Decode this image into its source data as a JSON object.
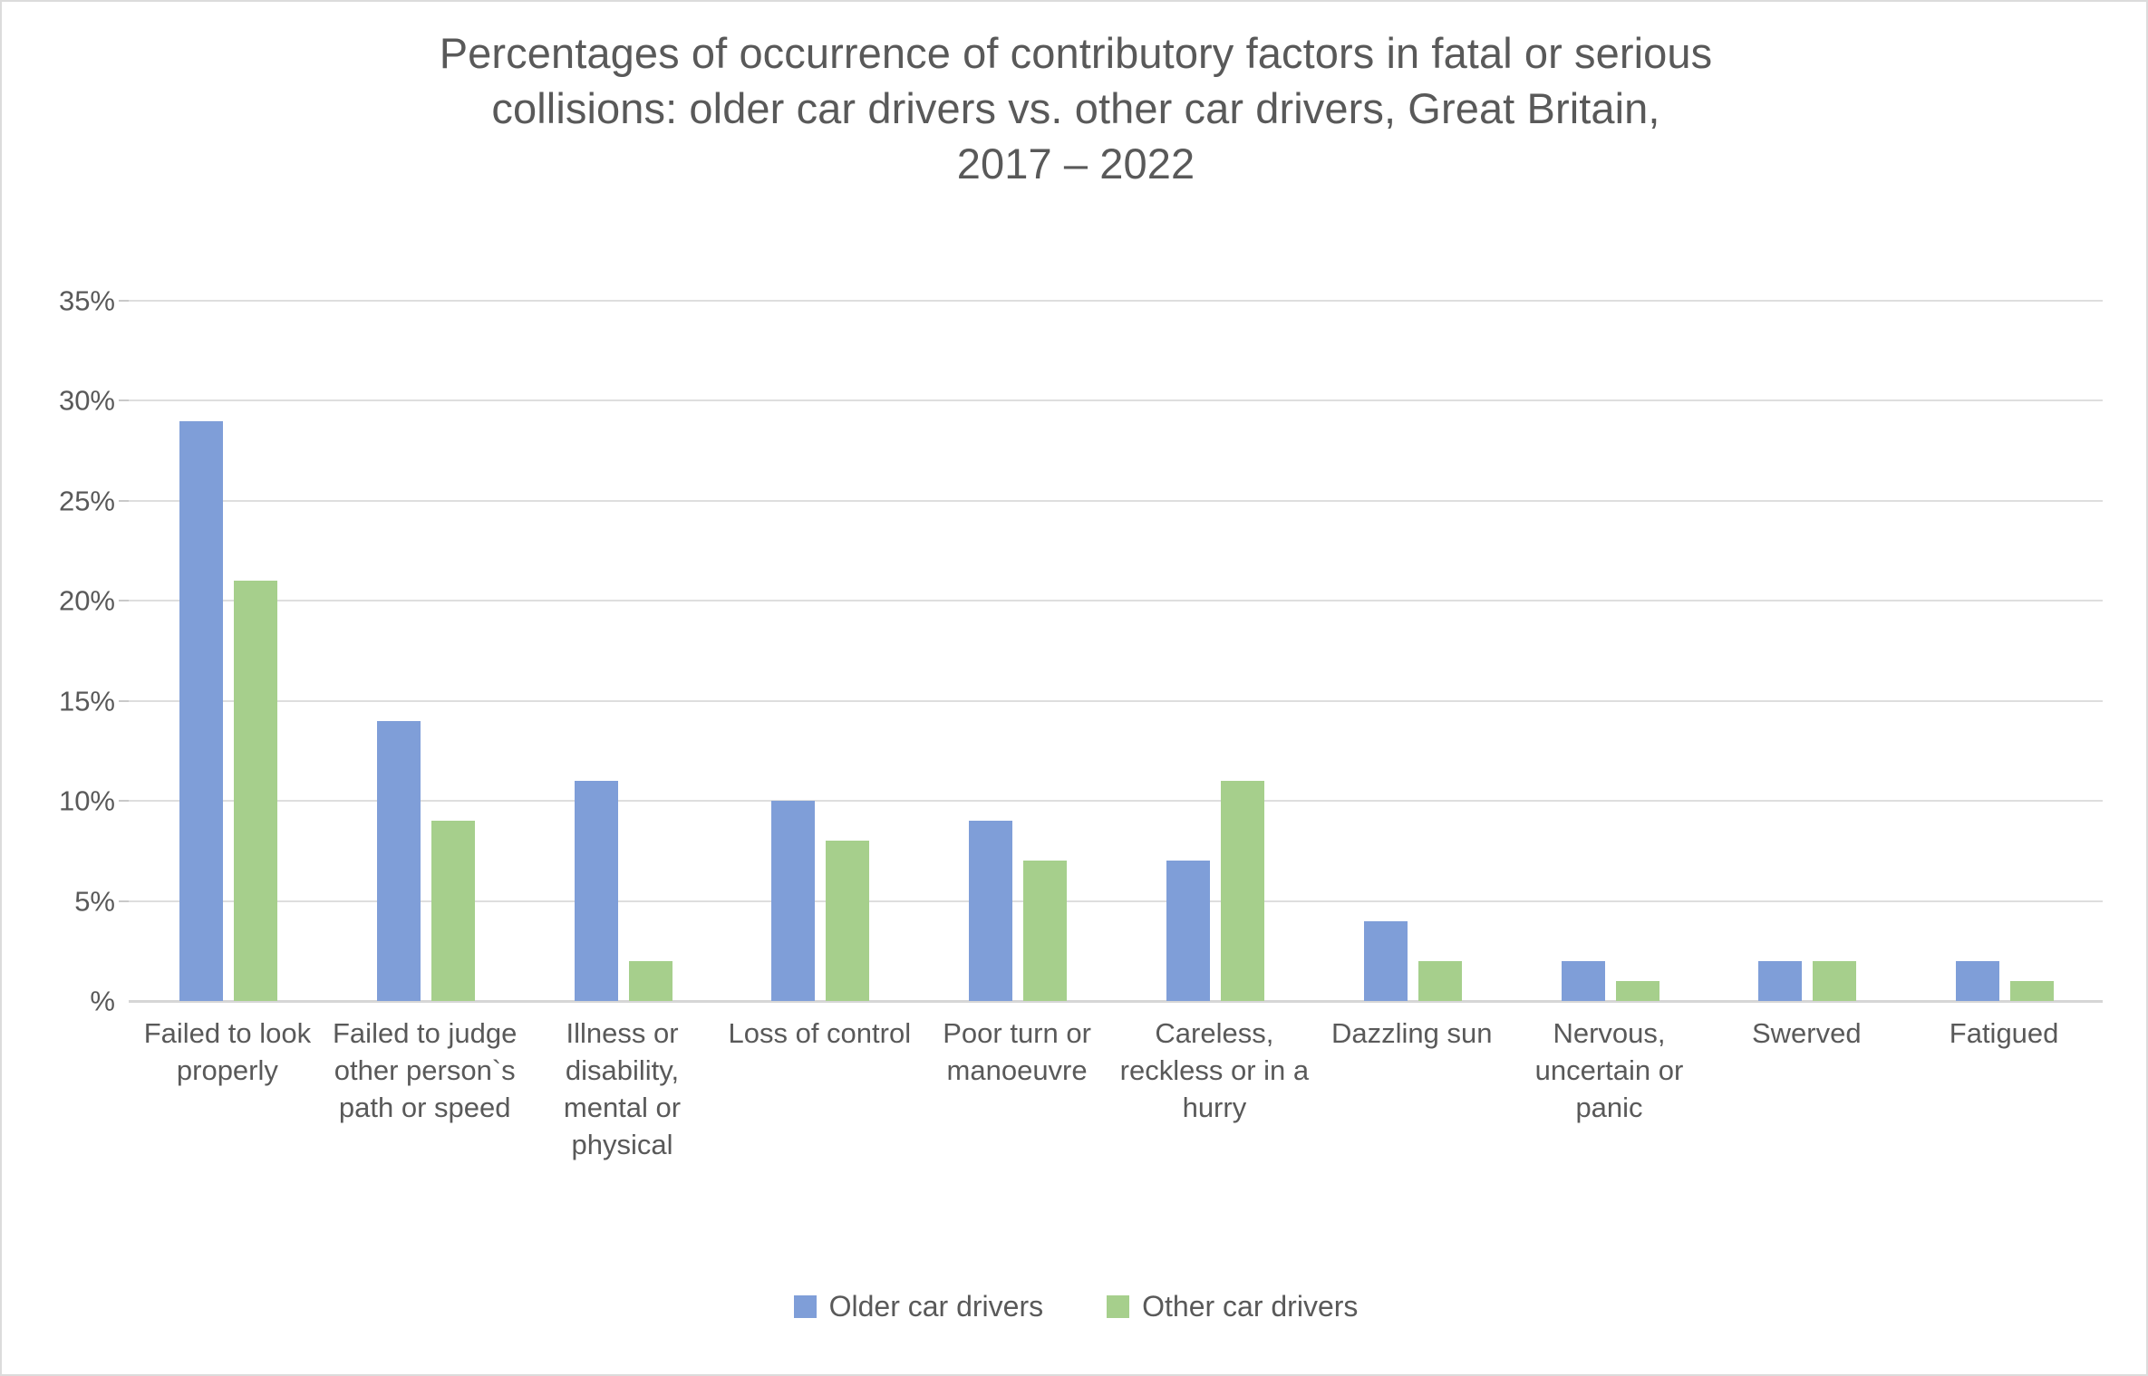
{
  "chart_data": {
    "type": "bar",
    "title": "Percentages of occurrence of contributory factors in fatal or serious collisions: older car drivers vs. other car drivers, Great Britain, 2017 – 2022",
    "title_lines": [
      "Percentages of occurrence of contributory factors in fatal or serious",
      "collisions: older car drivers vs. other car drivers, Great Britain,",
      "2017 – 2022"
    ],
    "subtitle": "",
    "xlabel": "",
    "ylabel": "",
    "ylim": [
      0,
      35
    ],
    "ytick_values": [
      35,
      30,
      25,
      20,
      15,
      10,
      5,
      0
    ],
    "ytick_labels": [
      "35%",
      "30%",
      "25%",
      "20%",
      "15%",
      "10%",
      "5%",
      "%"
    ],
    "grid": true,
    "legend_position": "bottom",
    "categories": [
      "Failed to look properly",
      "Failed to judge other person`s path or speed",
      "Illness or disability, mental or physical",
      "Loss of control",
      "Poor turn or manoeuvre",
      "Careless, reckless or in a hurry",
      "Dazzling sun",
      "Nervous, uncertain or panic",
      "Swerved",
      "Fatigued"
    ],
    "series": [
      {
        "name": "Older car drivers",
        "color": "#7f9ed8",
        "values": [
          29,
          14,
          11,
          10,
          9,
          7,
          4,
          2,
          2,
          2
        ]
      },
      {
        "name": "Other car drivers",
        "color": "#a6cf8c",
        "values": [
          21,
          9,
          2,
          8,
          7,
          11,
          2,
          1,
          2,
          1
        ]
      }
    ]
  }
}
